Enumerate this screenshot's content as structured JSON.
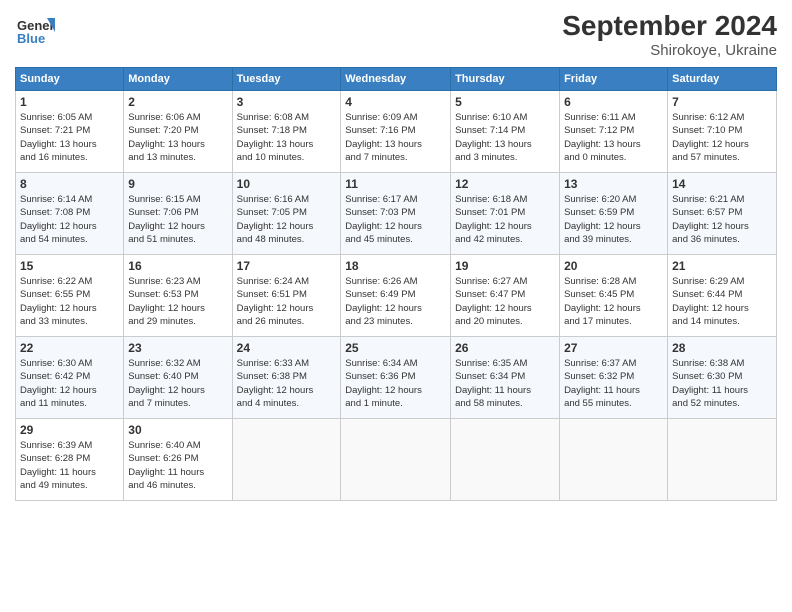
{
  "logo": {
    "line1": "General",
    "line2": "Blue"
  },
  "title": "September 2024",
  "subtitle": "Shirokoye, Ukraine",
  "days_of_week": [
    "Sunday",
    "Monday",
    "Tuesday",
    "Wednesday",
    "Thursday",
    "Friday",
    "Saturday"
  ],
  "weeks": [
    [
      {
        "day": "1",
        "info": "Sunrise: 6:05 AM\nSunset: 7:21 PM\nDaylight: 13 hours\nand 16 minutes."
      },
      {
        "day": "2",
        "info": "Sunrise: 6:06 AM\nSunset: 7:20 PM\nDaylight: 13 hours\nand 13 minutes."
      },
      {
        "day": "3",
        "info": "Sunrise: 6:08 AM\nSunset: 7:18 PM\nDaylight: 13 hours\nand 10 minutes."
      },
      {
        "day": "4",
        "info": "Sunrise: 6:09 AM\nSunset: 7:16 PM\nDaylight: 13 hours\nand 7 minutes."
      },
      {
        "day": "5",
        "info": "Sunrise: 6:10 AM\nSunset: 7:14 PM\nDaylight: 13 hours\nand 3 minutes."
      },
      {
        "day": "6",
        "info": "Sunrise: 6:11 AM\nSunset: 7:12 PM\nDaylight: 13 hours\nand 0 minutes."
      },
      {
        "day": "7",
        "info": "Sunrise: 6:12 AM\nSunset: 7:10 PM\nDaylight: 12 hours\nand 57 minutes."
      }
    ],
    [
      {
        "day": "8",
        "info": "Sunrise: 6:14 AM\nSunset: 7:08 PM\nDaylight: 12 hours\nand 54 minutes."
      },
      {
        "day": "9",
        "info": "Sunrise: 6:15 AM\nSunset: 7:06 PM\nDaylight: 12 hours\nand 51 minutes."
      },
      {
        "day": "10",
        "info": "Sunrise: 6:16 AM\nSunset: 7:05 PM\nDaylight: 12 hours\nand 48 minutes."
      },
      {
        "day": "11",
        "info": "Sunrise: 6:17 AM\nSunset: 7:03 PM\nDaylight: 12 hours\nand 45 minutes."
      },
      {
        "day": "12",
        "info": "Sunrise: 6:18 AM\nSunset: 7:01 PM\nDaylight: 12 hours\nand 42 minutes."
      },
      {
        "day": "13",
        "info": "Sunrise: 6:20 AM\nSunset: 6:59 PM\nDaylight: 12 hours\nand 39 minutes."
      },
      {
        "day": "14",
        "info": "Sunrise: 6:21 AM\nSunset: 6:57 PM\nDaylight: 12 hours\nand 36 minutes."
      }
    ],
    [
      {
        "day": "15",
        "info": "Sunrise: 6:22 AM\nSunset: 6:55 PM\nDaylight: 12 hours\nand 33 minutes."
      },
      {
        "day": "16",
        "info": "Sunrise: 6:23 AM\nSunset: 6:53 PM\nDaylight: 12 hours\nand 29 minutes."
      },
      {
        "day": "17",
        "info": "Sunrise: 6:24 AM\nSunset: 6:51 PM\nDaylight: 12 hours\nand 26 minutes."
      },
      {
        "day": "18",
        "info": "Sunrise: 6:26 AM\nSunset: 6:49 PM\nDaylight: 12 hours\nand 23 minutes."
      },
      {
        "day": "19",
        "info": "Sunrise: 6:27 AM\nSunset: 6:47 PM\nDaylight: 12 hours\nand 20 minutes."
      },
      {
        "day": "20",
        "info": "Sunrise: 6:28 AM\nSunset: 6:45 PM\nDaylight: 12 hours\nand 17 minutes."
      },
      {
        "day": "21",
        "info": "Sunrise: 6:29 AM\nSunset: 6:44 PM\nDaylight: 12 hours\nand 14 minutes."
      }
    ],
    [
      {
        "day": "22",
        "info": "Sunrise: 6:30 AM\nSunset: 6:42 PM\nDaylight: 12 hours\nand 11 minutes."
      },
      {
        "day": "23",
        "info": "Sunrise: 6:32 AM\nSunset: 6:40 PM\nDaylight: 12 hours\nand 7 minutes."
      },
      {
        "day": "24",
        "info": "Sunrise: 6:33 AM\nSunset: 6:38 PM\nDaylight: 12 hours\nand 4 minutes."
      },
      {
        "day": "25",
        "info": "Sunrise: 6:34 AM\nSunset: 6:36 PM\nDaylight: 12 hours\nand 1 minute."
      },
      {
        "day": "26",
        "info": "Sunrise: 6:35 AM\nSunset: 6:34 PM\nDaylight: 11 hours\nand 58 minutes."
      },
      {
        "day": "27",
        "info": "Sunrise: 6:37 AM\nSunset: 6:32 PM\nDaylight: 11 hours\nand 55 minutes."
      },
      {
        "day": "28",
        "info": "Sunrise: 6:38 AM\nSunset: 6:30 PM\nDaylight: 11 hours\nand 52 minutes."
      }
    ],
    [
      {
        "day": "29",
        "info": "Sunrise: 6:39 AM\nSunset: 6:28 PM\nDaylight: 11 hours\nand 49 minutes."
      },
      {
        "day": "30",
        "info": "Sunrise: 6:40 AM\nSunset: 6:26 PM\nDaylight: 11 hours\nand 46 minutes."
      },
      {
        "day": "",
        "info": ""
      },
      {
        "day": "",
        "info": ""
      },
      {
        "day": "",
        "info": ""
      },
      {
        "day": "",
        "info": ""
      },
      {
        "day": "",
        "info": ""
      }
    ]
  ]
}
